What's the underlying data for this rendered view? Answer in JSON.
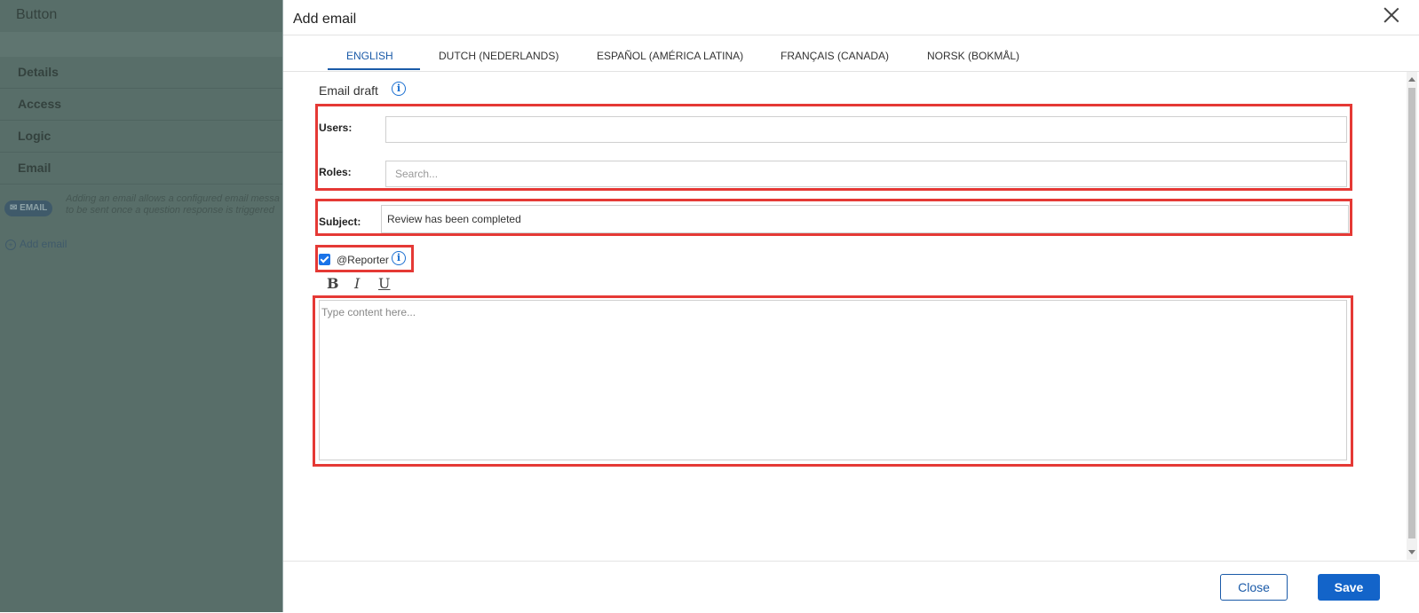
{
  "background": {
    "title": "Button",
    "nav_items": [
      {
        "label": "Details"
      },
      {
        "label": "Access"
      },
      {
        "label": "Logic"
      },
      {
        "label": "Email"
      }
    ],
    "email_badge": "EMAIL",
    "email_description_line1": "Adding an email allows a configured email messa",
    "email_description_line2": "to be sent once a question response is triggered",
    "add_email_link": "Add email"
  },
  "modal": {
    "title": "Add email",
    "tabs": [
      {
        "label": "ENGLISH",
        "active": true
      },
      {
        "label": "DUTCH (NEDERLANDS)",
        "active": false
      },
      {
        "label": "ESPAÑOL (AMÉRICA LATINA)",
        "active": false
      },
      {
        "label": "FRANÇAIS (CANADA)",
        "active": false
      },
      {
        "label": "NORSK (BOKMÅL)",
        "active": false
      }
    ],
    "draft_label": "Email draft",
    "users_label": "Users:",
    "users_value": "",
    "roles_label": "Roles:",
    "roles_placeholder": "Search...",
    "subject_label": "Subject:",
    "subject_value": "Review has been completed",
    "reporter_label": "@Reporter",
    "reporter_checked": true,
    "format_buttons": {
      "bold": "B",
      "italic": "I",
      "underline": "U"
    },
    "editor_placeholder": "Type content here...",
    "close_button": "Close",
    "save_button": "Save"
  },
  "colors": {
    "accent": "#1a5aa8",
    "highlight_box": "#e53935",
    "overlay": "#586e69"
  }
}
